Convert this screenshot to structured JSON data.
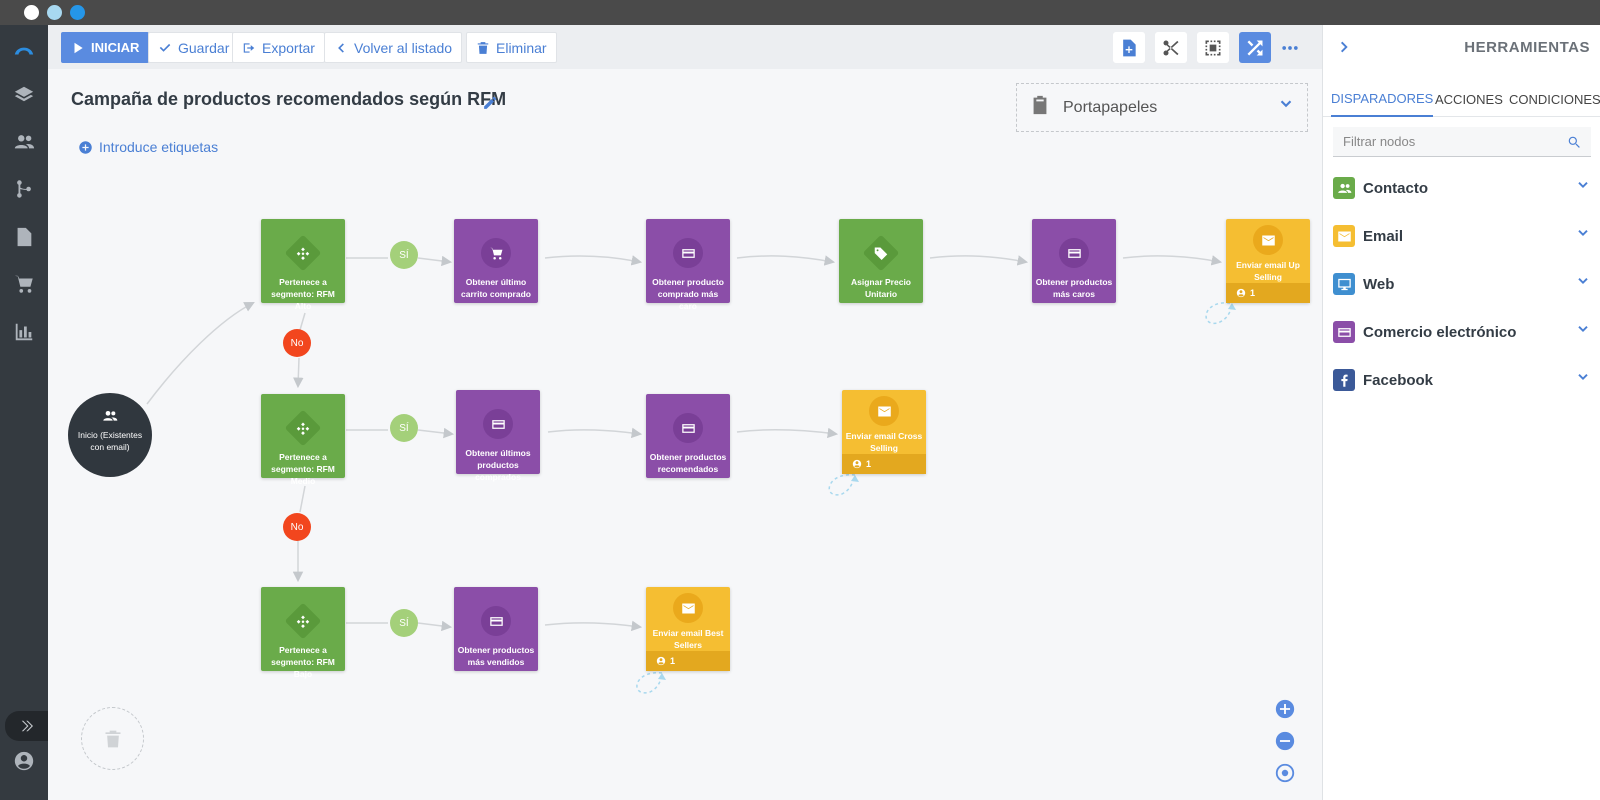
{
  "toolbar": {
    "start_label": "INICIAR",
    "save_label": "Guardar",
    "export_label": "Exportar",
    "back_label": "Volver al listado",
    "delete_label": "Eliminar"
  },
  "campaign": {
    "title": "Campaña de productos recomendados según RFM",
    "tags_link": "Introduce etiquetas"
  },
  "clipboard": {
    "label": "Portapapeles"
  },
  "flow": {
    "start": {
      "label": "Inicio (Existentes con email)"
    },
    "branch_yes": "SÍ",
    "branch_no": "No",
    "row1": [
      {
        "label": "Pertenece a segmento: RFM Alto",
        "icon": "segment-icon",
        "color": "green"
      },
      {
        "label": "Obtener último carrito comprado",
        "icon": "cart-icon",
        "color": "purple"
      },
      {
        "label": "Obtener producto comprado más caro",
        "icon": "card-icon",
        "color": "purple"
      },
      {
        "label": "Asignar Precio Unitario",
        "icon": "tag-icon",
        "color": "green"
      },
      {
        "label": "Obtener productos más caros",
        "icon": "card-icon",
        "color": "purple"
      },
      {
        "label": "Enviar email Up Selling",
        "icon": "mail-icon",
        "color": "yellow",
        "count": "1"
      }
    ],
    "row2": [
      {
        "label": "Pertenece a segmento: RFM Medio",
        "icon": "segment-icon",
        "color": "green"
      },
      {
        "label": "Obtener últimos productos comprados",
        "icon": "card-icon",
        "color": "purple"
      },
      {
        "label": "Obtener productos recomendados",
        "icon": "card-icon",
        "color": "purple"
      },
      {
        "label": "Enviar email Cross Selling",
        "icon": "mail-icon",
        "color": "yellow",
        "count": "1"
      }
    ],
    "row3": [
      {
        "label": "Pertenece a segmento: RFM Bajo",
        "icon": "segment-icon",
        "color": "green"
      },
      {
        "label": "Obtener productos más vendidos",
        "icon": "card-icon",
        "color": "purple"
      },
      {
        "label": "Enviar email Best Sellers",
        "icon": "mail-icon",
        "color": "yellow",
        "count": "1"
      }
    ]
  },
  "panel": {
    "title": "HERRAMIENTAS",
    "tabs": [
      "DISPARADORES",
      "ACCIONES",
      "CONDICIONES"
    ],
    "active_tab": "DISPARADORES",
    "filter_placeholder": "Filtrar nodos",
    "categories": [
      {
        "label": "Contacto",
        "icon": "contacts-icon",
        "color": "#6aab4a"
      },
      {
        "label": "Email",
        "icon": "mail-icon",
        "color": "#f5be32"
      },
      {
        "label": "Web",
        "icon": "monitor-icon",
        "color": "#3f8fd0"
      },
      {
        "label": "Comercio electrónico",
        "icon": "card-icon",
        "color": "#8b4ea8"
      },
      {
        "label": "Facebook",
        "icon": "facebook-icon",
        "color": "#3b5998"
      }
    ]
  },
  "colors": {
    "accent": "#4a7fd4",
    "primary_button": "#5a8be0",
    "node_green": "#6aab4a",
    "node_purple": "#8b4ea8",
    "node_yellow": "#f5be32",
    "yes_badge": "#a4d07a",
    "no_badge": "#f2461e",
    "rail": "#343a40"
  }
}
